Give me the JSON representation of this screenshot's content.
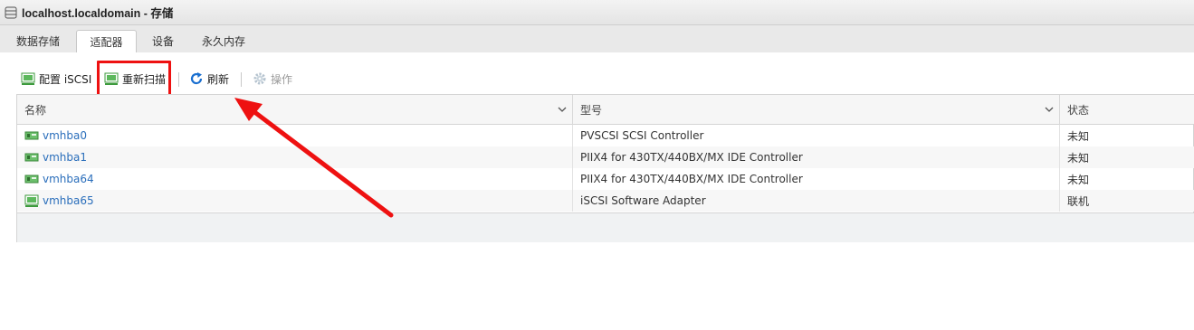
{
  "window": {
    "title": "localhost.localdomain - 存储",
    "icon": "database-icon"
  },
  "tabs": [
    {
      "label": "数据存储",
      "active": false
    },
    {
      "label": "适配器",
      "active": true
    },
    {
      "label": "设备",
      "active": false
    },
    {
      "label": "永久内存",
      "active": false
    }
  ],
  "toolbar": {
    "configure_iscsi": {
      "label": "配置 iSCSI",
      "icon": "network-adapter-icon"
    },
    "rescan": {
      "label": "重新扫描",
      "icon": "network-adapter-icon"
    },
    "refresh": {
      "label": "刷新",
      "icon": "refresh-icon"
    },
    "actions": {
      "label": "操作",
      "icon": "gear-icon",
      "disabled": true
    }
  },
  "table": {
    "columns": [
      {
        "label": "名称",
        "sortable": true
      },
      {
        "label": "型号",
        "sortable": true
      },
      {
        "label": "状态",
        "sortable": false
      }
    ],
    "rows": [
      {
        "name": "vmhba0",
        "model": "PVSCSI SCSI Controller",
        "status": "未知",
        "icon": "hba-card-icon"
      },
      {
        "name": "vmhba1",
        "model": "PIIX4 for 430TX/440BX/MX IDE Controller",
        "status": "未知",
        "icon": "hba-card-icon"
      },
      {
        "name": "vmhba64",
        "model": "PIIX4 for 430TX/440BX/MX IDE Controller",
        "status": "未知",
        "icon": "hba-card-icon"
      },
      {
        "name": "vmhba65",
        "model": "iSCSI Software Adapter",
        "status": "联机",
        "icon": "network-adapter-icon"
      }
    ]
  },
  "annotation": {
    "highlight_color": "#ee1111",
    "target": "rescan"
  },
  "colors": {
    "link": "#2a6ebb",
    "refresh_icon": "#1a6fd0",
    "adapter_icon": "#3c9a3c"
  }
}
